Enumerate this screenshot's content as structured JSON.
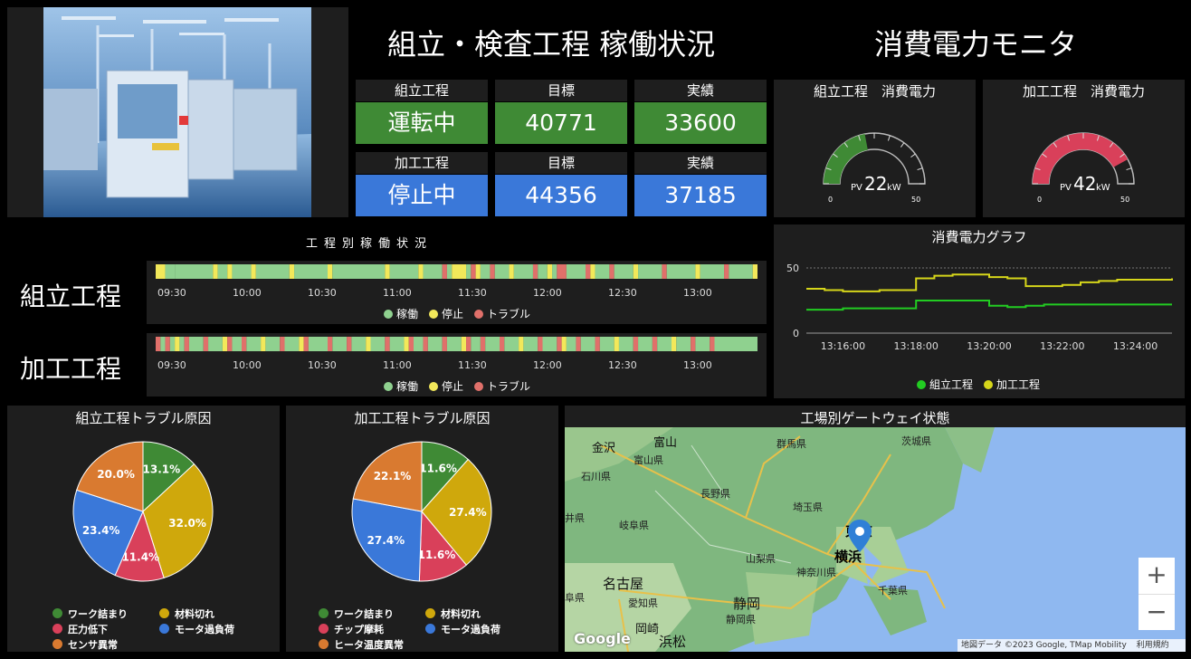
{
  "header": {
    "title_left": "組立・検査工程 稼働状況",
    "title_right": "消費電力モニタ"
  },
  "stats": {
    "assembly": {
      "label": "組立工程",
      "status": "運転中",
      "target_label": "目標",
      "target": "40771",
      "actual_label": "実績",
      "actual": "33600",
      "color": "#3f8a35"
    },
    "process": {
      "label": "加工工程",
      "status": "停止中",
      "target_label": "目標",
      "target": "44356",
      "actual_label": "実績",
      "actual": "37185",
      "color": "#3a78d9"
    }
  },
  "gauges": [
    {
      "title": "組立工程　消費電力",
      "pv_label": "PV",
      "value": 22,
      "unit": "kW",
      "min": 0,
      "max": 50,
      "min_label": "0",
      "max_label": "50",
      "color": "#3f8a35"
    },
    {
      "title": "加工工程　消費電力",
      "pv_label": "PV",
      "value": 42,
      "unit": "kW",
      "min": 0,
      "max": 50,
      "min_label": "0",
      "max_label": "50",
      "color": "#d9405a"
    }
  ],
  "timeline": {
    "section_title": "工程別稼働状況",
    "ticks": [
      "09:30",
      "10:00",
      "10:30",
      "11:00",
      "11:30",
      "12:00",
      "12:30",
      "13:00"
    ],
    "legend": [
      {
        "label": "稼働",
        "color": "#8fd18f"
      },
      {
        "label": "停止",
        "color": "#f2e85a"
      },
      {
        "label": "トラブル",
        "color": "#e0706a"
      }
    ],
    "rows": [
      {
        "label": "組立工程"
      },
      {
        "label": "加工工程"
      }
    ]
  },
  "power_chart": {
    "title": "消費電力グラフ",
    "legend": [
      {
        "label": "組立工程",
        "color": "#22cc22"
      },
      {
        "label": "加工工程",
        "color": "#d6d61a"
      }
    ]
  },
  "chart_data": [
    {
      "type": "line",
      "title": "消費電力グラフ",
      "x": [
        "13:15:00",
        "13:15:30",
        "13:16:00",
        "13:16:30",
        "13:17:00",
        "13:17:30",
        "13:18:00",
        "13:18:30",
        "13:19:00",
        "13:19:30",
        "13:20:00",
        "13:20:30",
        "13:21:00",
        "13:21:30",
        "13:22:00",
        "13:22:30",
        "13:23:00",
        "13:23:30",
        "13:24:00",
        "13:24:30",
        "13:25:00"
      ],
      "x_ticks": [
        "13:16:00",
        "13:18:00",
        "13:20:00",
        "13:22:00",
        "13:24:00"
      ],
      "y_ticks": [
        "0",
        "50"
      ],
      "ylim": [
        0,
        50
      ],
      "series": [
        {
          "name": "組立工程",
          "values": [
            18,
            18,
            19,
            19,
            19,
            19,
            25,
            25,
            25,
            25,
            21,
            20,
            21,
            22,
            22,
            22,
            22,
            22,
            22,
            22,
            22
          ]
        },
        {
          "name": "加工工程",
          "values": [
            34,
            33,
            32,
            32,
            33,
            33,
            42,
            44,
            45,
            45,
            43,
            42,
            36,
            36,
            37,
            39,
            40,
            41,
            41,
            41,
            42
          ]
        }
      ]
    },
    {
      "type": "pie",
      "title": "組立工程トラブル原因",
      "categories": [
        "ワーク詰まり",
        "材料切れ",
        "圧力低下",
        "モータ過負荷",
        "センサ異常"
      ],
      "values": [
        13.1,
        32.0,
        11.4,
        23.4,
        20.0
      ],
      "labels": [
        "13.1%",
        "32.0%",
        "11.4%",
        "23.4%",
        "20.0%"
      ],
      "colors": [
        "#3f8a35",
        "#cfa80c",
        "#d9405a",
        "#3a78d9",
        "#d97a30"
      ]
    },
    {
      "type": "pie",
      "title": "加工工程トラブル原因",
      "categories": [
        "ワーク詰まり",
        "材料切れ",
        "チップ摩耗",
        "モータ過負荷",
        "ヒータ温度異常"
      ],
      "values": [
        11.6,
        27.4,
        11.6,
        27.4,
        22.1
      ],
      "labels": [
        "11.6%",
        "27.4%",
        "11.6%",
        "27.4%",
        "22.1%"
      ],
      "colors": [
        "#3f8a35",
        "#cfa80c",
        "#d9405a",
        "#3a78d9",
        "#d97a30"
      ]
    }
  ],
  "map": {
    "title": "工場別ゲートウェイ状態",
    "labels": [
      "金沢",
      "富山",
      "富山県",
      "石川県",
      "群馬県",
      "茨城県",
      "長野県",
      "埼玉県",
      "井県",
      "岐阜県",
      "山梨県",
      "東京",
      "横浜",
      "神奈川県",
      "千葉県",
      "名古屋",
      "愛知県",
      "静岡",
      "静岡県",
      "岡崎",
      "浜松",
      "阜県"
    ],
    "attribution": "地図データ ©2023 Google, TMap Mobility",
    "terms": "利用規約",
    "google": "Google",
    "zoom_in": "+",
    "zoom_out": "−"
  }
}
